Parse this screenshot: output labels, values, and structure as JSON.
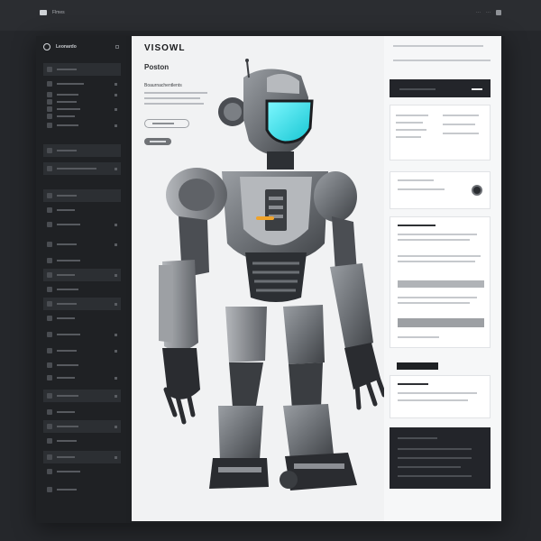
{
  "topbar": {
    "brand_label": "Flmes",
    "right_labels": [
      "···",
      "···"
    ]
  },
  "sidebar": {
    "title": "Leonardo",
    "items": []
  },
  "hero": {
    "title": "VISOWL",
    "subtitle": "Poston",
    "description": "Boaurnachentlents"
  },
  "colors": {
    "visor": "#2fe7f0",
    "accent": "#f0a32a",
    "canvas_bg": "#f1f2f3",
    "dark_bg": "#1f2124"
  }
}
